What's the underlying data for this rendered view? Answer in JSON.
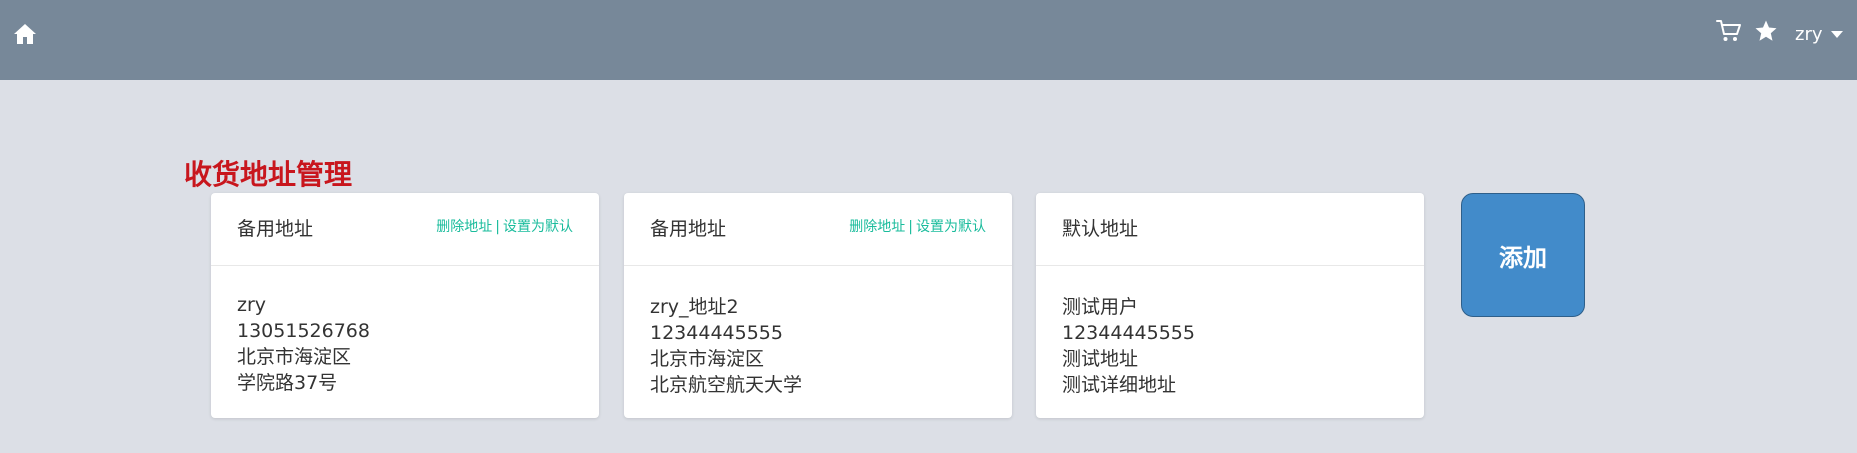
{
  "navbar": {
    "home_icon": "home-icon",
    "cart_icon": "cart-icon",
    "star_icon": "star-icon",
    "username": "zry",
    "bg_color": "#778899"
  },
  "page": {
    "title": "收货地址管理",
    "title_color": "#c8161d"
  },
  "cards": [
    {
      "label": "备用地址",
      "actions": [
        "删除地址",
        "设置为默认"
      ],
      "separator": "|",
      "name": "zry",
      "phone": "13051526768",
      "region": "北京市海淀区",
      "detail": "学院路37号"
    },
    {
      "label": "备用地址",
      "actions": [
        "删除地址",
        "设置为默认"
      ],
      "separator": "|",
      "name": "zry_地址2",
      "phone": "12344445555",
      "region": "北京市海淀区",
      "detail": "北京航空航天大学"
    },
    {
      "label": "默认地址",
      "actions": [],
      "name": "测试用户",
      "phone": "12344445555",
      "region": "测试地址",
      "detail": "测试详细地址"
    }
  ],
  "add_button": {
    "label": "添加",
    "color": "#428bca"
  },
  "accent_link_color": "#1abc9c"
}
